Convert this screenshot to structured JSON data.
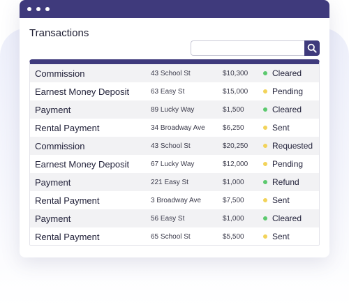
{
  "page": {
    "title": "Transactions"
  },
  "search": {
    "value": "",
    "placeholder": "",
    "button_icon": "search-icon"
  },
  "colors": {
    "accent": "#3f3a7c",
    "status_green": "#5cc96e",
    "status_yellow": "#f2d35a"
  },
  "transactions": [
    {
      "type": "Commission",
      "address": "43 School St",
      "amount": "$10,300",
      "status": "Cleared",
      "status_color": "#5cc96e"
    },
    {
      "type": "Earnest Money Deposit",
      "address": "63 Easy St",
      "amount": "$15,000",
      "status": "Pending",
      "status_color": "#f2d35a"
    },
    {
      "type": "Payment",
      "address": "89 Lucky Way",
      "amount": "$1,500",
      "status": "Cleared",
      "status_color": "#5cc96e"
    },
    {
      "type": "Rental Payment",
      "address": "34 Broadway Ave",
      "amount": "$6,250",
      "status": "Sent",
      "status_color": "#f2d35a"
    },
    {
      "type": "Commission",
      "address": "43 School St",
      "amount": "$20,250",
      "status": "Requested",
      "status_color": "#f2d35a"
    },
    {
      "type": "Earnest Money Deposit",
      "address": "67 Lucky Way",
      "amount": "$12,000",
      "status": "Pending",
      "status_color": "#f2d35a"
    },
    {
      "type": "Payment",
      "address": "221 Easy St",
      "amount": "$1,000",
      "status": "Refund",
      "status_color": "#5cc96e"
    },
    {
      "type": "Rental Payment",
      "address": "3 Broadway Ave",
      "amount": "$7,500",
      "status": "Sent",
      "status_color": "#f2d35a"
    },
    {
      "type": "Payment",
      "address": "56 Easy St",
      "amount": "$1,000",
      "status": "Cleared",
      "status_color": "#5cc96e"
    },
    {
      "type": "Rental Payment",
      "address": "65 School St",
      "amount": "$5,500",
      "status": "Sent",
      "status_color": "#f2d35a"
    }
  ]
}
